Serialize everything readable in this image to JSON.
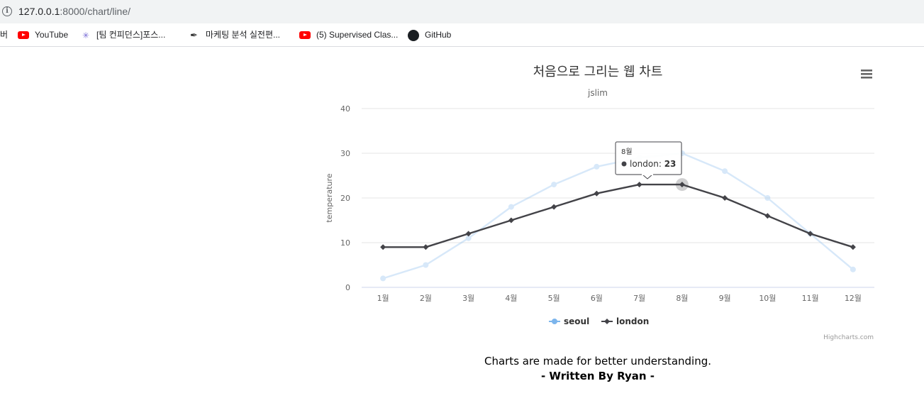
{
  "browser": {
    "url_host": "127.0.0.1",
    "url_rest": ":8000/chart/line/",
    "bookmarks": [
      {
        "label": "버",
        "icon": "none"
      },
      {
        "label": "YouTube",
        "icon": "youtube-icon"
      },
      {
        "label": "[팀 컨피던스]포스...",
        "icon": "team-icon"
      },
      {
        "label": "마케팅 분석 실전편...",
        "icon": "pen-icon"
      },
      {
        "label": "(5) Supervised Clas...",
        "icon": "youtube-icon"
      },
      {
        "label": "GitHub",
        "icon": "github-icon"
      }
    ]
  },
  "chart_data": {
    "type": "line",
    "title": "처음으로 그리는 웹 차트",
    "subtitle": "jslim",
    "ylabel": "temperature",
    "xlabel": "",
    "ylim": [
      0,
      40
    ],
    "yticks": [
      0,
      10,
      20,
      30,
      40
    ],
    "categories": [
      "1월",
      "2월",
      "3월",
      "4월",
      "5월",
      "6월",
      "7월",
      "8월",
      "9월",
      "10월",
      "11월",
      "12월"
    ],
    "series": [
      {
        "name": "seoul",
        "color": "#7cb5ec",
        "faded": true,
        "values": [
          2,
          5,
          11,
          18,
          23,
          27,
          29,
          30,
          26,
          20,
          12,
          4
        ]
      },
      {
        "name": "london",
        "color": "#434348",
        "faded": false,
        "values": [
          9,
          9,
          12,
          15,
          18,
          21,
          23,
          23,
          20,
          16,
          12,
          9
        ]
      }
    ],
    "grid": true,
    "legend": "bottom-center",
    "tooltip": {
      "category": "8월",
      "series": "london",
      "value": 23,
      "index": 7
    },
    "credits": "Highcharts.com"
  },
  "caption": {
    "line1": "Charts are made for better understanding.",
    "line2": "- Written By Ryan -"
  }
}
